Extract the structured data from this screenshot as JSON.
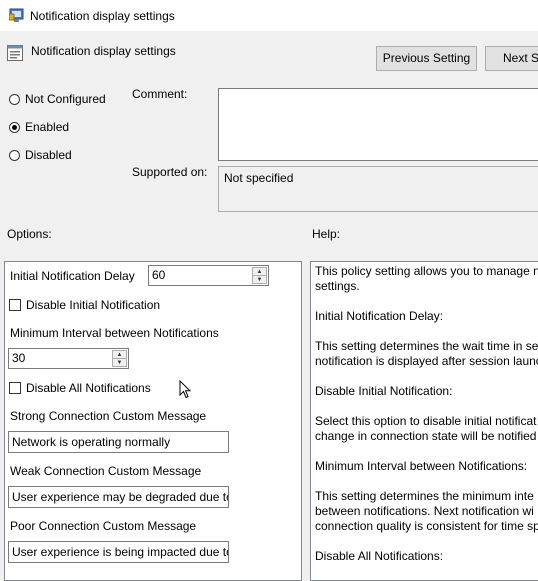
{
  "window": {
    "title": "Notification display settings"
  },
  "header": {
    "title": "Notification display settings",
    "prev_button": "Previous Setting",
    "next_button": "Next Setting"
  },
  "state": {
    "options": [
      "Not Configured",
      "Enabled",
      "Disabled"
    ],
    "selected": "Enabled"
  },
  "comment": {
    "label": "Comment:",
    "value": ""
  },
  "supported": {
    "label": "Supported on:",
    "value": "Not specified"
  },
  "options_label": "Options:",
  "help_label": "Help:",
  "options_panel": {
    "initial_delay_label": "Initial Notification Delay",
    "initial_delay_value": "60",
    "disable_initial_label": "Disable Initial Notification",
    "disable_initial_checked": false,
    "min_interval_label": "Minimum Interval between Notifications",
    "min_interval_value": "30",
    "disable_all_label": "Disable All Notifications",
    "disable_all_checked": false,
    "strong_label": "Strong Connection Custom Message",
    "strong_value": "Network is operating normally",
    "weak_label": "Weak Connection Custom Message",
    "weak_value": "User experience may be degraded due to",
    "poor_label": "Poor Connection Custom Message",
    "poor_value": "User experience is being impacted due to"
  },
  "help_text": [
    "This policy setting allows you to manage n",
    "settings.",
    "Initial Notification Delay:",
    "This setting determines the wait time in se",
    "notification is displayed after session launc",
    "Disable Initial Notification:",
    "Select this option to disable initial notificat",
    "change in connection state will be notified",
    "Minimum Interval between Notifications:",
    "This setting determines the minimum inte",
    "between notifications. Next notification wi",
    "connection quality is consistent for time sp",
    "Disable All Notifications:"
  ]
}
